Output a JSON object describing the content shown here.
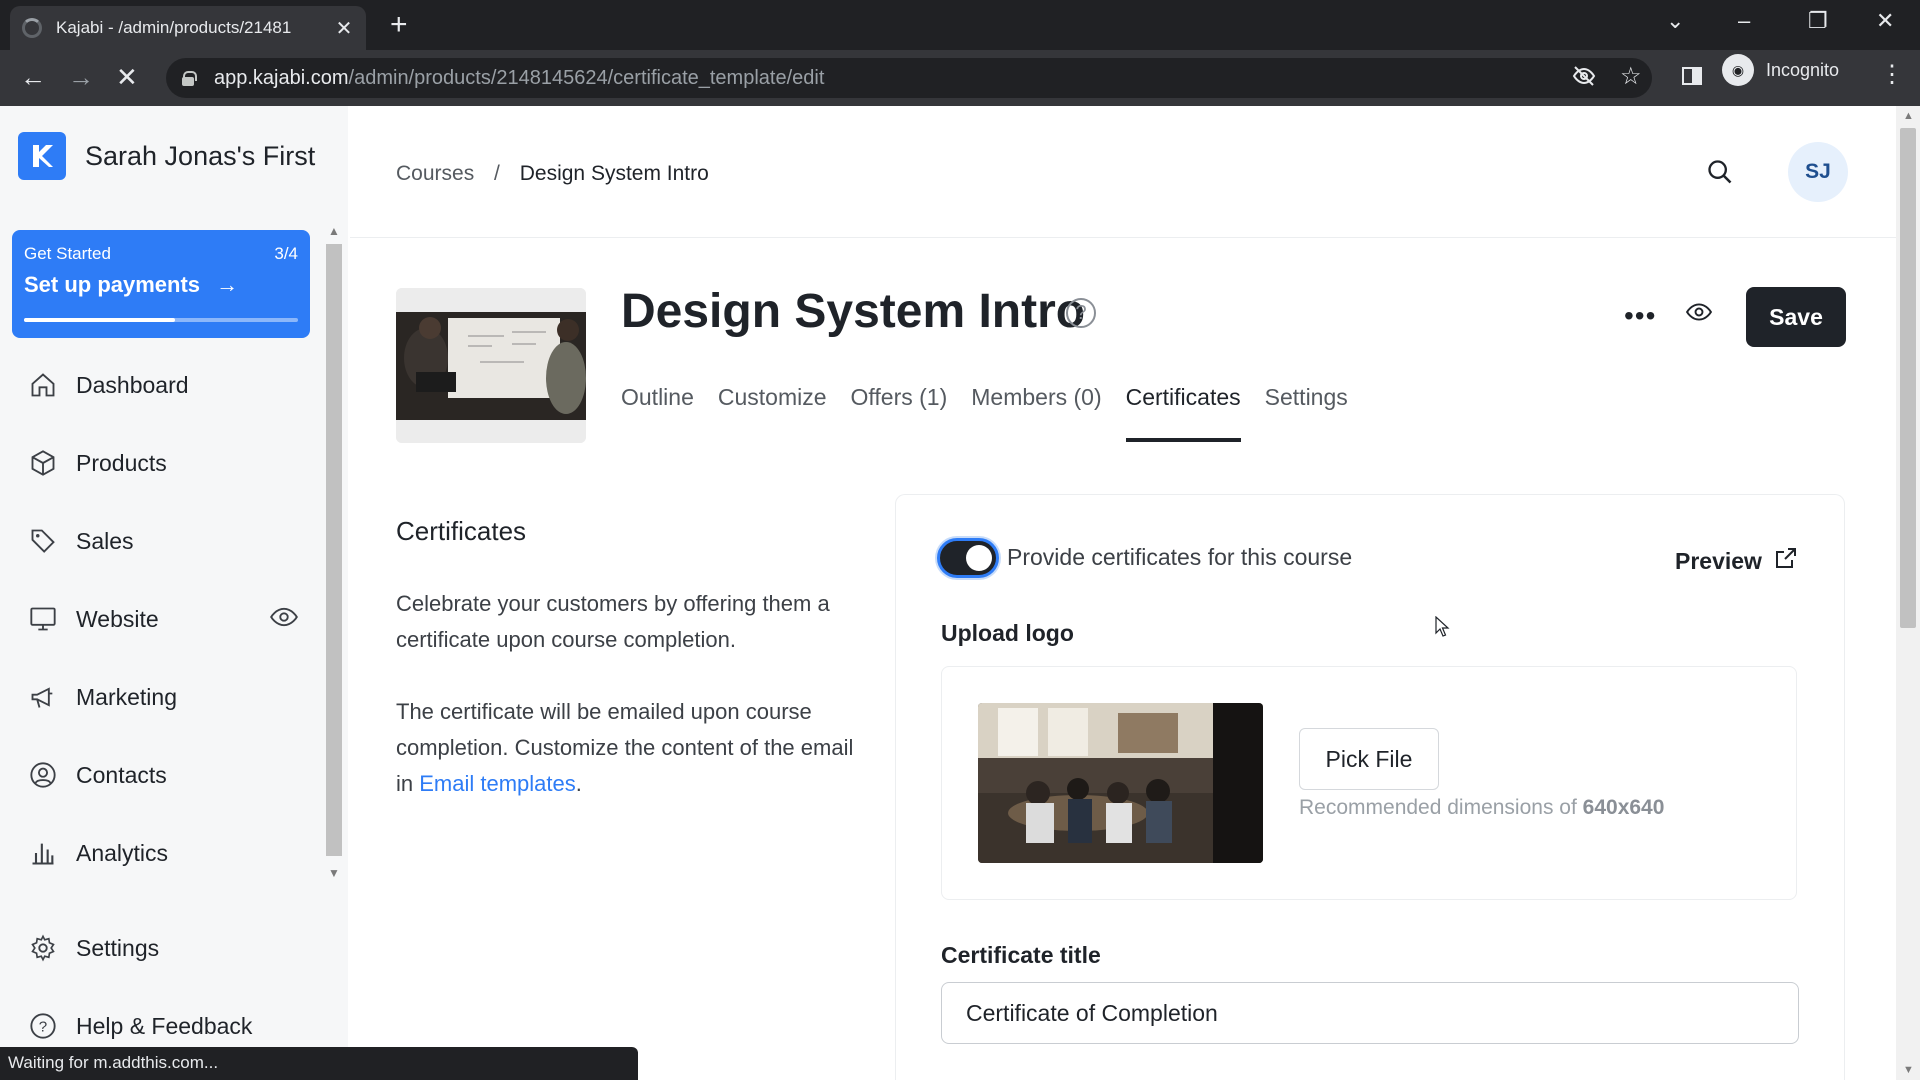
{
  "browser": {
    "tab_title": "Kajabi - /admin/products/21481",
    "url_host": "app.kajabi.com",
    "url_path": "/admin/products/2148145624/certificate_template/edit",
    "profile_label": "Incognito",
    "status_text": "Waiting for m.addthis.com..."
  },
  "sidebar": {
    "brand_name": "Sarah Jonas's First",
    "setup": {
      "label": "Get Started",
      "progress_text": "3/4",
      "progress_fraction": 0.55,
      "action": "Set up payments"
    },
    "items": [
      {
        "label": "Dashboard",
        "icon": "home-icon"
      },
      {
        "label": "Products",
        "icon": "box-icon"
      },
      {
        "label": "Sales",
        "icon": "tag-icon"
      },
      {
        "label": "Website",
        "icon": "monitor-icon"
      },
      {
        "label": "Marketing",
        "icon": "megaphone-icon"
      },
      {
        "label": "Contacts",
        "icon": "user-circle-icon"
      },
      {
        "label": "Analytics",
        "icon": "bar-chart-icon"
      },
      {
        "label": "Settings",
        "icon": "gear-icon"
      },
      {
        "label": "Help & Feedback",
        "icon": "help-circle-icon"
      }
    ]
  },
  "header": {
    "breadcrumb": {
      "parent": "Courses",
      "separator": "/",
      "current": "Design System Intro"
    },
    "avatar_initials": "SJ"
  },
  "product": {
    "title": "Design System Intro",
    "save_label": "Save",
    "tabs": [
      {
        "label": "Outline"
      },
      {
        "label": "Customize"
      },
      {
        "label": "Offers (1)"
      },
      {
        "label": "Members (0)"
      },
      {
        "label": "Certificates"
      },
      {
        "label": "Settings"
      }
    ],
    "active_tab": "Certificates"
  },
  "certificates": {
    "heading": "Certificates",
    "description_1": "Celebrate your customers by offering them a certificate upon course completion.",
    "description_2_prefix": "The certificate will be emailed upon course completion. Customize the content of the email in ",
    "description_2_link": "Email templates",
    "description_2_suffix": ".",
    "toggle_label": "Provide certificates for this course",
    "toggle_on": true,
    "preview_label": "Preview",
    "upload_label": "Upload logo",
    "pick_file_label": "Pick File",
    "recommended_prefix": "Recommended dimensions of",
    "recommended_dims": "640x640",
    "title_label": "Certificate title",
    "title_value": "Certificate of Completion"
  },
  "colors": {
    "accent": "#2e7cf6",
    "dark": "#1f2329",
    "link": "#2e7cf6"
  }
}
